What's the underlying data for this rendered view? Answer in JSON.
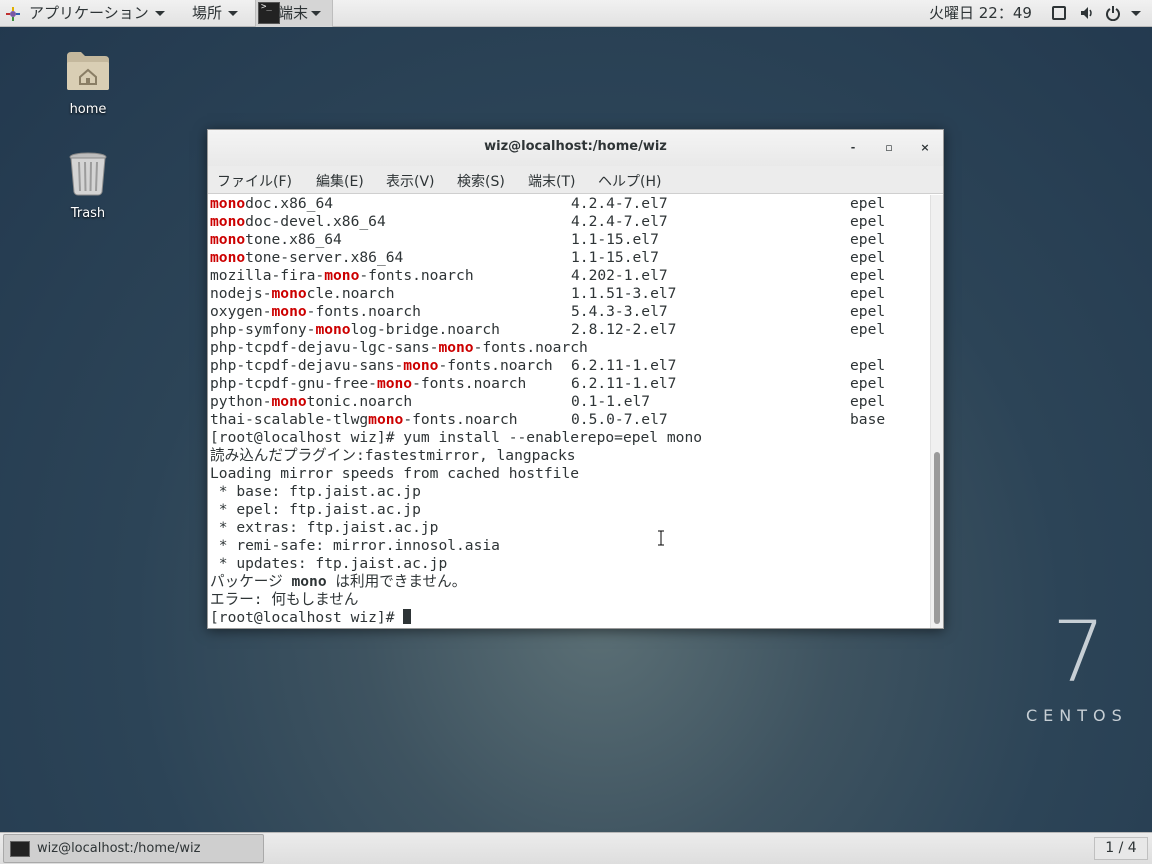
{
  "topbar": {
    "apps_label": "アプリケーション",
    "places_label": "場所",
    "terminal_task_label": "端末",
    "clock": "火曜日 22：49",
    "icons": [
      "applications-icon",
      "terminal-icon",
      "window-icon",
      "volume-icon",
      "power-icon",
      "chevron-down-icon"
    ]
  },
  "desktop": {
    "home_label": "home",
    "trash_label": "Trash",
    "logo_number": "7",
    "logo_word": "CENTOS"
  },
  "window": {
    "title": "wiz@localhost:/home/wiz",
    "menu": [
      "ファイル(F)",
      "編集(E)",
      "表示(V)",
      "検索(S)",
      "端末(T)",
      "ヘルプ(H)"
    ],
    "minimize": "-",
    "maximize": "▫",
    "close": "×"
  },
  "terminal": {
    "packages": [
      {
        "pre": "",
        "hl": "mono",
        "post": "doc.x86_64",
        "version": "4.2.4-7.el7",
        "repo": "epel"
      },
      {
        "pre": "",
        "hl": "mono",
        "post": "doc-devel.x86_64",
        "version": "4.2.4-7.el7",
        "repo": "epel"
      },
      {
        "pre": "",
        "hl": "mono",
        "post": "tone.x86_64",
        "version": "1.1-15.el7",
        "repo": "epel"
      },
      {
        "pre": "",
        "hl": "mono",
        "post": "tone-server.x86_64",
        "version": "1.1-15.el7",
        "repo": "epel"
      },
      {
        "pre": "mozilla-fira-",
        "hl": "mono",
        "post": "-fonts.noarch",
        "version": "4.202-1.el7",
        "repo": "epel"
      },
      {
        "pre": "nodejs-",
        "hl": "mono",
        "post": "cle.noarch",
        "version": "1.1.51-3.el7",
        "repo": "epel"
      },
      {
        "pre": "oxygen-",
        "hl": "mono",
        "post": "-fonts.noarch",
        "version": "5.4.3-3.el7",
        "repo": "epel"
      },
      {
        "pre": "php-symfony-",
        "hl": "mono",
        "post": "log-bridge.noarch",
        "version": "2.8.12-2.el7",
        "repo": "epel"
      },
      {
        "pre": "php-tcpdf-dejavu-lgc-sans-",
        "hl": "mono",
        "post": "-fonts.noarch",
        "version": "",
        "repo": ""
      },
      {
        "pre": "php-tcpdf-dejavu-sans-",
        "hl": "mono",
        "post": "-fonts.noarch",
        "version": "6.2.11-1.el7",
        "repo": "epel"
      },
      {
        "pre": "php-tcpdf-gnu-free-",
        "hl": "mono",
        "post": "-fonts.noarch",
        "version": "6.2.11-1.el7",
        "repo": "epel"
      },
      {
        "pre": "python-",
        "hl": "mono",
        "post": "tonic.noarch",
        "version": "0.1-1.el7",
        "repo": "epel"
      },
      {
        "pre": "thai-scalable-tlwg",
        "hl": "mono",
        "post": "-fonts.noarch",
        "version": "0.5.0-7.el7",
        "repo": "base"
      }
    ],
    "command_line": "[root@localhost wiz]# yum install --enablerepo=epel mono",
    "output": [
      "読み込んだプラグイン:fastestmirror, langpacks",
      "Loading mirror speeds from cached hostfile",
      " * base: ftp.jaist.ac.jp",
      " * epel: ftp.jaist.ac.jp",
      " * extras: ftp.jaist.ac.jp",
      " * remi-safe: mirror.innosol.asia",
      " * updates: ftp.jaist.ac.jp"
    ],
    "unavailable_pre": "パッケージ ",
    "unavailable_pkg": "mono",
    "unavailable_post": " は利用できません。",
    "error_line": "エラー: 何もしません",
    "prompt": "[root@localhost wiz]# "
  },
  "taskbar": {
    "task_label": "wiz@localhost:/home/wiz",
    "workspace": "1 / 4"
  }
}
